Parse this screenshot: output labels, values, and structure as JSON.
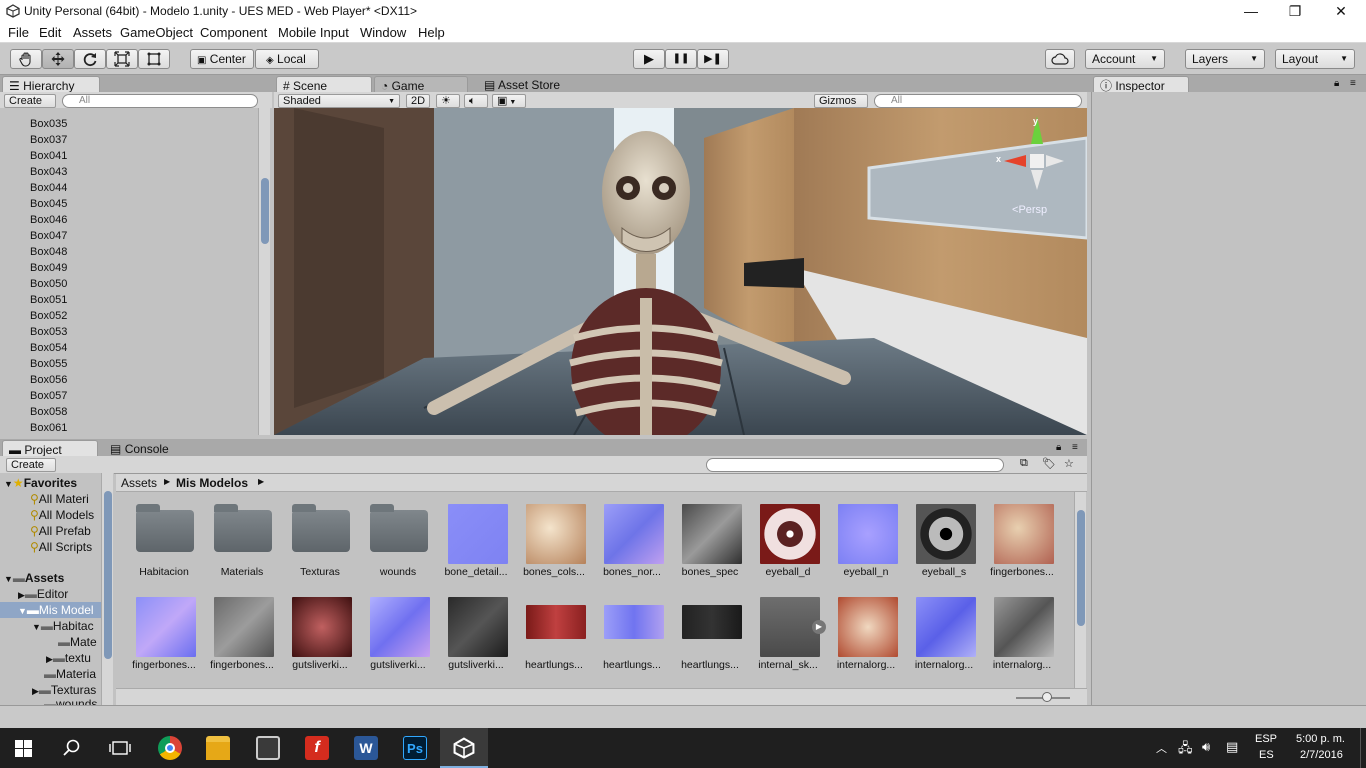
{
  "window": {
    "title": "Unity Personal (64bit) - Modelo 1.unity - UES MED - Web Player* <DX11>",
    "minimize": "—",
    "restore": "❐",
    "close": "✕"
  },
  "menu": [
    "File",
    "Edit",
    "Assets",
    "GameObject",
    "Component",
    "Mobile Input",
    "Window",
    "Help"
  ],
  "toolbar": {
    "tools": [
      "hand-icon",
      "move-icon",
      "rotate-icon",
      "scale-icon",
      "rect-icon"
    ],
    "center": "Center",
    "local": "Local",
    "play": "▶",
    "pause": "❚❚",
    "step": "▶❚",
    "account": "Account",
    "layers": "Layers",
    "layout": "Layout"
  },
  "hierarchy": {
    "tab": "Hierarchy",
    "create": "Create",
    "search_placeholder": "All",
    "items": [
      "Box035",
      "Box037",
      "Box041",
      "Box043",
      "Box044",
      "Box045",
      "Box046",
      "Box047",
      "Box048",
      "Box049",
      "Box050",
      "Box051",
      "Box052",
      "Box053",
      "Box054",
      "Box055",
      "Box056",
      "Box057",
      "Box058",
      "Box061"
    ]
  },
  "scene_tabs": {
    "scene": "Scene",
    "game": "Game",
    "asset_store": "Asset Store"
  },
  "scene_bar": {
    "shaded": "Shaded",
    "twod": "2D",
    "gizmos": "Gizmos",
    "search_placeholder": "All",
    "persp": "Persp",
    "axis_y": "y",
    "axis_x": "x"
  },
  "inspector": {
    "tab": "Inspector"
  },
  "project": {
    "tab": "Project",
    "console": "Console",
    "create": "Create",
    "breadcrumb": [
      "Assets",
      "Mis Modelos"
    ],
    "tree": {
      "favorites": "Favorites",
      "fav_items": [
        "All Materi",
        "All Models",
        "All Prefab",
        "All Scripts"
      ],
      "assets": "Assets",
      "editor": "Editor",
      "mis_modelos": "Mis Model",
      "habitacion": "Habitac",
      "mate": "Mate",
      "textu": "textu",
      "materials": "Materia",
      "texturas": "Texturas",
      "wounds": "wounds"
    },
    "row1": [
      "Habitacion",
      "Materials",
      "Texturas",
      "wounds",
      "bone_detail...",
      "bones_cols...",
      "bones_nor...",
      "bones_spec",
      "eyeball_d",
      "eyeball_n",
      "eyeball_s",
      "fingerbones..."
    ],
    "row2": [
      "fingerbones...",
      "fingerbones...",
      "gutsliverki...",
      "gutsliverki...",
      "gutsliverki...",
      "heartlungs...",
      "heartlungs...",
      "heartlungs...",
      "internal_sk...",
      "internalorg...",
      "internalorg...",
      "internalorg..."
    ]
  },
  "taskbar": {
    "lang1": "ESP",
    "lang2": "ES",
    "time": "5:00 p. m.",
    "date": "2/7/2016"
  },
  "colors": {
    "accent": "#3d6ea5",
    "selection": "#3e7bc8",
    "taskbar": "#1f1f1f"
  }
}
